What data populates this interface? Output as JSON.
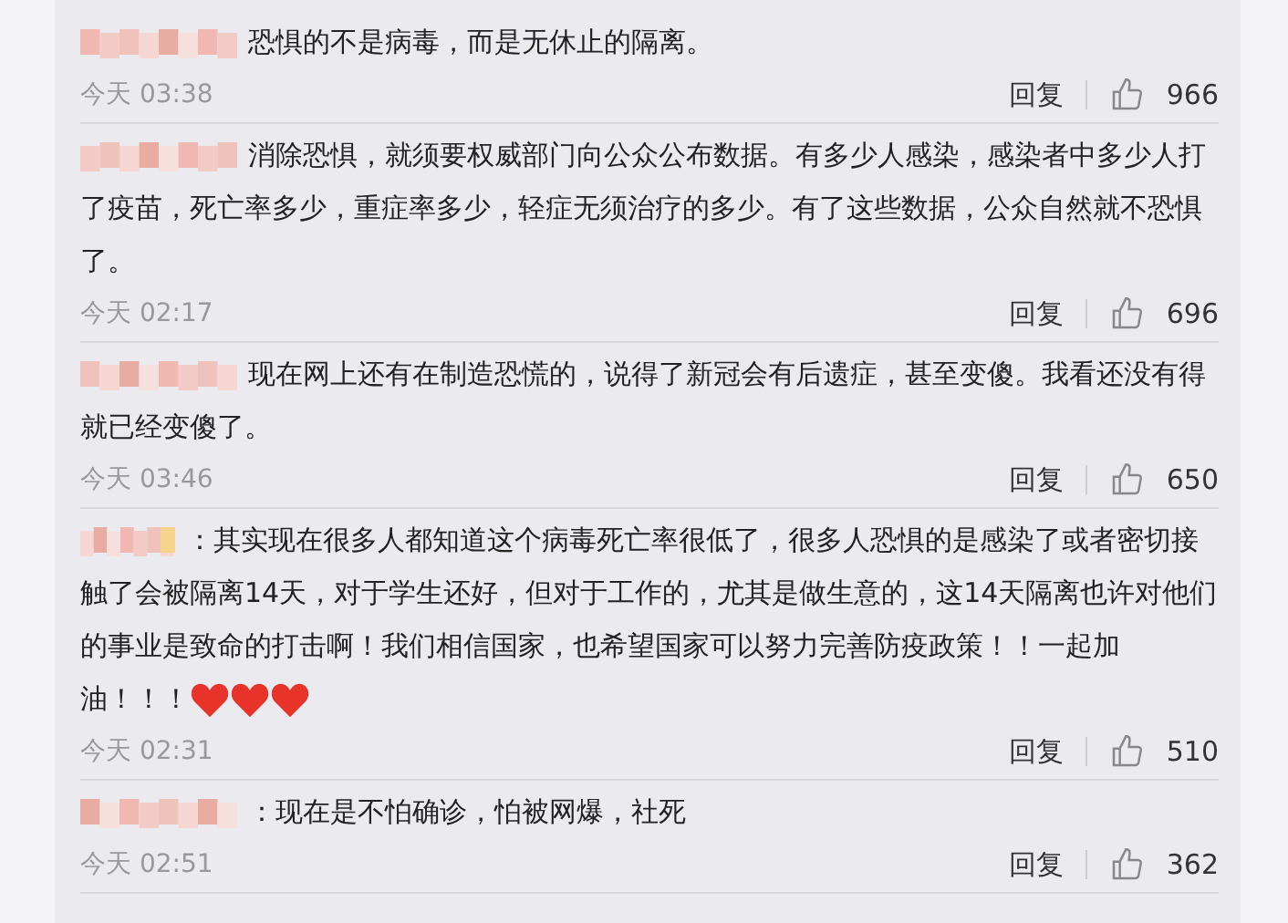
{
  "comments": [
    {
      "text": "恐惧的不是病毒，而是无休止的隔离。",
      "time": "今天 03:38",
      "reply": "回复",
      "likes": "966"
    },
    {
      "text": "消除恐惧，就须要权威部门向公众公布数据。有多少人感染，感染者中多少人打了疫苗，死亡率多少，重症率多少，轻症无须治疗的多少。有了这些数据，公众自然就不恐惧了。",
      "time": "今天 02:17",
      "reply": "回复",
      "likes": "696"
    },
    {
      "text": "现在网上还有在制造恐慌的，说得了新冠会有后遗症，甚至变傻。我看还没有得就已经变傻了。",
      "time": "今天 03:46",
      "reply": "回复",
      "likes": "650"
    },
    {
      "text": "：其实现在很多人都知道这个病毒死亡率很低了，很多人恐惧的是感染了或者密切接触了会被隔离14天，对于学生还好，但对于工作的，尤其是做生意的，这14天隔离也许对他们的事业是致命的打击啊！我们相信国家，也希望国家可以努力完善防疫政策！！一起加油！！！",
      "emojis": [
        {
          "kind": "heart"
        },
        {
          "kind": "heart"
        },
        {
          "kind": "heart"
        }
      ],
      "time": "今天 02:31",
      "reply": "回复",
      "likes": "510"
    },
    {
      "text": "：现在是不怕确诊，怕被网爆，社死",
      "time": "今天 02:51",
      "reply": "回复",
      "likes": "362"
    }
  ]
}
